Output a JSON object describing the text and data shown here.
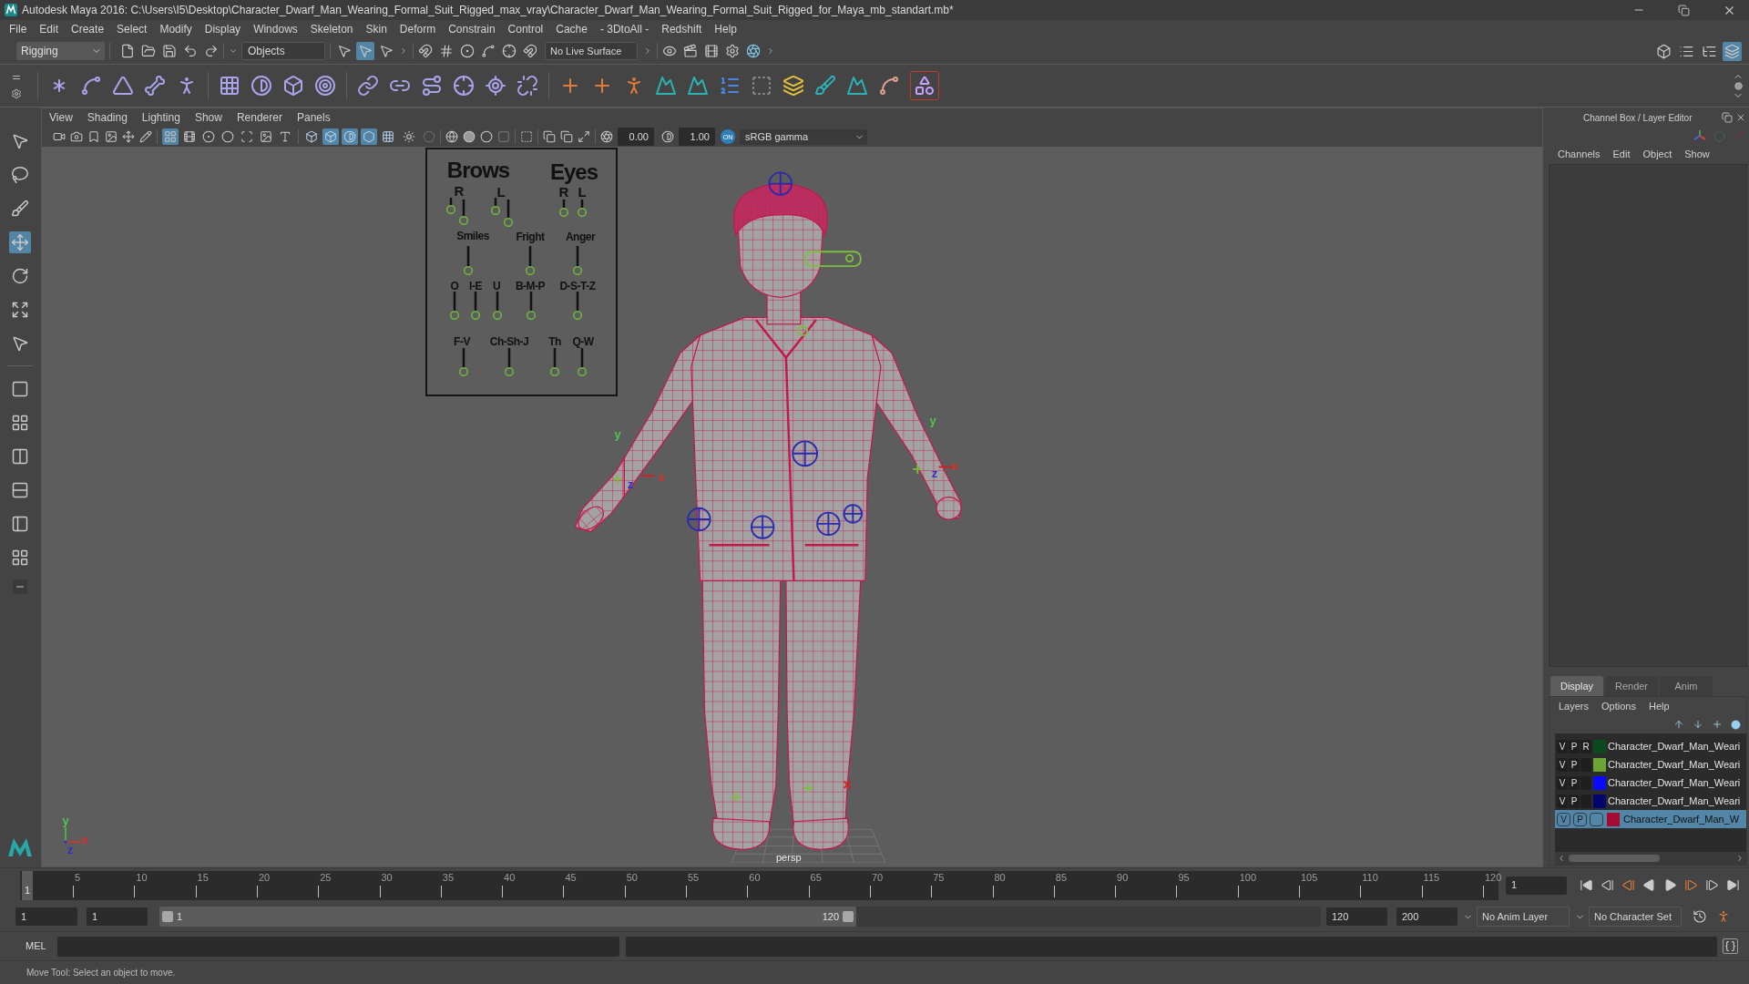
{
  "window": {
    "title": "Autodesk Maya 2016: C:\\Users\\I5\\Desktop\\Character_Dwarf_Man_Wearing_Formal_Suit_Rigged_max_vray\\Character_Dwarf_Man_Wearing_Formal_Suit_Rigged_for_Maya_mb_standart.mb*"
  },
  "menu_bar": [
    "File",
    "Edit",
    "Create",
    "Select",
    "Modify",
    "Display",
    "Windows",
    "Skeleton",
    "Skin",
    "Deform",
    "Constrain",
    "Control",
    "Cache",
    "- 3DtoAll -",
    "Redshift",
    "Help"
  ],
  "status_line": {
    "menu_set": "Rigging",
    "selection_masks": [
      {
        "selected": false
      },
      {
        "selected": true
      },
      {
        "selected": false
      }
    ],
    "selection_mode": "Objects",
    "live_surface": "No Live Surface",
    "panel_toggles": [
      {
        "selected": false
      },
      {
        "selected": false
      },
      {
        "selected": false
      },
      {
        "selected": true
      }
    ]
  },
  "toolbox": {
    "tools": [
      {
        "selected": false
      },
      {
        "selected": false
      },
      {
        "selected": false
      },
      {
        "selected": true
      },
      {
        "selected": false
      },
      {
        "selected": false
      },
      {
        "selected": false
      }
    ]
  },
  "viewport": {
    "menus": [
      "View",
      "Shading",
      "Lighting",
      "Show",
      "Renderer",
      "Panels"
    ],
    "display_toggles": [
      {
        "selected": true
      },
      {
        "selected": false
      },
      {
        "selected": false
      },
      {
        "selected": false
      },
      {
        "selected": false
      },
      {
        "selected": false
      },
      {
        "selected": false
      }
    ],
    "shading_toggles": [
      {
        "selected": false
      },
      {
        "selected": true
      },
      {
        "selected": true
      },
      {
        "selected": true
      },
      {
        "selected": false
      }
    ],
    "exposure": "0.00",
    "gamma": "1.00",
    "color_management": "ON",
    "color_space": "sRGB gamma",
    "face_board": {
      "titles": [
        "Brows",
        "Eyes"
      ],
      "side_labels": [
        "R",
        "L",
        "R",
        "L"
      ],
      "shape_labels": [
        "Smiles",
        "Fright",
        "Anger",
        "O",
        "I-E",
        "U",
        "B-M-P",
        "D-S-T-Z",
        "F-V",
        "Ch-Sh-J",
        "Th",
        "Q-W"
      ]
    },
    "wrist_manipulators": [
      {
        "labels": [
          {
            "text": "y",
            "color": "#4ec64e"
          },
          {
            "text": "z",
            "color": "#2f2fd0"
          },
          {
            "text": "x",
            "color": "#d83030"
          }
        ]
      },
      {
        "labels": [
          {
            "text": "y",
            "color": "#4ec64e"
          },
          {
            "text": "z",
            "color": "#2f2fd0"
          },
          {
            "text": "x",
            "color": "#d83030"
          }
        ]
      }
    ],
    "axis_indicator": {
      "labels": [
        {
          "text": "y",
          "color": "#4ec64e"
        },
        {
          "text": "z",
          "color": "#2f2fd0"
        },
        {
          "text": "x",
          "color": "#d83030"
        }
      ]
    },
    "camera": "persp"
  },
  "channel_box": {
    "title": "Channel Box / Layer Editor",
    "menus": [
      "Channels",
      "Edit",
      "Object",
      "Show"
    ]
  },
  "layer_editor": {
    "tabs": [
      {
        "label": "Display",
        "selected": true
      },
      {
        "label": "Render",
        "selected": false
      },
      {
        "label": "Anim",
        "selected": false
      }
    ],
    "menus": [
      "Layers",
      "Options",
      "Help"
    ],
    "layers": [
      {
        "visibility": "V",
        "playback": "P",
        "display_type": "R",
        "color": "#0b4a1c",
        "name": "Character_Dwarf_Man_Weari",
        "selected": false
      },
      {
        "visibility": "V",
        "playback": "P",
        "color": "#6ba534",
        "name": "Character_Dwarf_Man_Weari",
        "selected": false
      },
      {
        "visibility": "V",
        "playback": "P",
        "color": "#0a0aff",
        "name": "Character_Dwarf_Man_Weari",
        "selected": false
      },
      {
        "visibility": "V",
        "playback": "P",
        "color": "#050570",
        "name": "Character_Dwarf_Man_Weari",
        "selected": false
      },
      {
        "visibility": "V",
        "playback": "P",
        "color": "#a50a33",
        "name": "Character_Dwarf_Man_W",
        "selected": true
      }
    ]
  },
  "time_slider": {
    "tick_labels": [
      "5",
      "10",
      "15",
      "20",
      "25",
      "30",
      "35",
      "40",
      "45",
      "50",
      "55",
      "60",
      "65",
      "70",
      "75",
      "80",
      "85",
      "90",
      "95",
      "100",
      "105",
      "110",
      "115",
      "120"
    ],
    "current_frame": "1",
    "level": 0,
    "current_frame_field": "1"
  },
  "range_slider": {
    "start_field": "1",
    "range_start_field": "1",
    "range_start": "1",
    "range_end": "120",
    "level": 0.6,
    "range_end_field": "120",
    "end_field": "200",
    "anim_layer": "No Anim Layer",
    "character_set": "No Character Set"
  },
  "command_line": {
    "label": "MEL"
  },
  "help_line": "Move Tool: Select an object to move."
}
